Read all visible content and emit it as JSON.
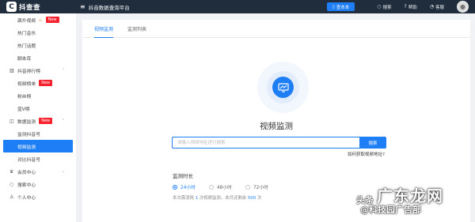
{
  "topbar": {
    "logo_mark": "C",
    "logo_text": "抖查查",
    "platform_title": "抖音数据查询平台",
    "app_button_label": "查本本",
    "links": [
      "搜索",
      "帮助",
      "客服"
    ]
  },
  "sidebar": {
    "items": [
      {
        "label": "飙升视频",
        "badge": "New",
        "fire": true
      },
      {
        "label": "热门音乐"
      },
      {
        "label": "热门话题"
      },
      {
        "label": "脚本库"
      }
    ],
    "group_rank": {
      "label": "抖音排行榜"
    },
    "rank_items": [
      {
        "label": "视频榜单",
        "badge": "New"
      },
      {
        "label": "粉丝榜"
      },
      {
        "label": "蓝V榜"
      }
    ],
    "group_monitor": {
      "label": "数据监测",
      "badge": "New"
    },
    "monitor_items": [
      {
        "label": "监测抖音号"
      },
      {
        "label": "视频监测",
        "active": true
      },
      {
        "label": "对比抖音号"
      }
    ],
    "bottom_groups": [
      {
        "label": "会员中心"
      },
      {
        "label": "搜索中心"
      },
      {
        "label": "个人中心"
      }
    ]
  },
  "main": {
    "tabs": [
      {
        "label": "视频监测",
        "active": true
      },
      {
        "label": "监测列表"
      }
    ],
    "title": "视频监测",
    "search": {
      "placeholder": "请输入视频地址进行搜索",
      "button_label": "搜索"
    },
    "help_link": "如何获取视频地址?",
    "duration_label": "监测时长",
    "durations": [
      {
        "label": "24小时",
        "selected": true
      },
      {
        "label": "48小时"
      },
      {
        "label": "72小时"
      }
    ],
    "quota": {
      "prefix": "本次需消耗",
      "cost": "1",
      "middle": "次视频监测，本月还剩余",
      "remaining": "500",
      "suffix": "次"
    }
  },
  "watermark": {
    "prefix": "头条",
    "brand": "广东龙网",
    "sub": "@科技园广告部"
  },
  "colors": {
    "accent": "#1e7ef5",
    "topbar": "#1f2d3d",
    "badge": "#f5222d"
  }
}
